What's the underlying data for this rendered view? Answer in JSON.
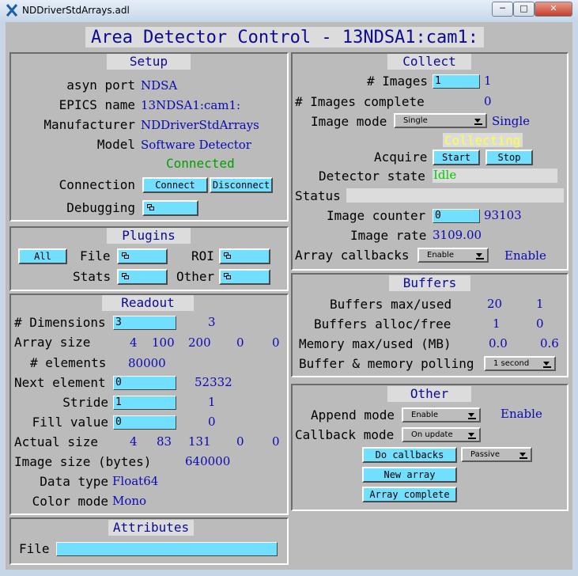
{
  "window": {
    "title": "NDDriverStdArrays.adl",
    "minimize": "─",
    "maximize": "□",
    "close": "✕"
  },
  "main_title": "Area Detector Control - 13NDSA1:cam1:",
  "setup": {
    "title": "Setup",
    "asyn_port_label": "asyn port",
    "asyn_port": "NDSA",
    "epics_name_label": "EPICS name",
    "epics_name": "13NDSA1:cam1:",
    "manufacturer_label": "Manufacturer",
    "manufacturer": "NDDriverStdArrays",
    "model_label": "Model",
    "model": "Software Detector",
    "connection_status": "Connected",
    "connection_label": "Connection",
    "connect_btn": "Connect",
    "disconnect_btn": "Disconnect",
    "debugging_label": "Debugging"
  },
  "plugins": {
    "title": "Plugins",
    "all_btn": "All",
    "file_label": "File",
    "roi_label": "ROI",
    "stats_label": "Stats",
    "other_label": "Other"
  },
  "readout": {
    "title": "Readout",
    "dims_label": "# Dimensions",
    "dims_input": "3",
    "dims_value": "3",
    "array_size_label": "Array size",
    "array_size": [
      "4",
      "100",
      "200",
      "0",
      "0"
    ],
    "elements_label": "# elements",
    "elements": "80000",
    "next_label": "Next element",
    "next_input": "0",
    "next_value": "52332",
    "stride_label": "Stride",
    "stride_input": "1",
    "stride_value": "1",
    "fill_label": "Fill value",
    "fill_input": "0",
    "fill_value": "0",
    "actual_label": "Actual size",
    "actual_size": [
      "4",
      "83",
      "131",
      "0",
      "0"
    ],
    "image_bytes_label": "Image size (bytes)",
    "image_bytes": "640000",
    "data_type_label": "Data type",
    "data_type": "Float64",
    "color_mode_label": "Color mode",
    "color_mode": "Mono"
  },
  "attributes": {
    "title": "Attributes",
    "file_label": "File",
    "file_value": ""
  },
  "collect": {
    "title": "Collect",
    "images_label": "# Images",
    "images_input": "1",
    "images_value": "1",
    "complete_label": "# Images complete",
    "complete_value": "0",
    "mode_label": "Image mode",
    "mode_select": "Single",
    "mode_value": "Single",
    "collecting": "Collecting",
    "acquire_label": "Acquire",
    "start_btn": "Start",
    "stop_btn": "Stop",
    "state_label": "Detector state",
    "state_value": "Idle",
    "status_label": "Status",
    "status_value": "",
    "counter_label": "Image counter",
    "counter_input": "0",
    "counter_value": "93103",
    "rate_label": "Image rate",
    "rate_value": "3109.00",
    "callbacks_label": "Array callbacks",
    "callbacks_select": "Enable",
    "callbacks_value": "Enable"
  },
  "buffers": {
    "title": "Buffers",
    "max_used_label": "Buffers max/used",
    "max": "20",
    "used": "1",
    "alloc_free_label": "Buffers alloc/free",
    "alloc": "1",
    "free": "0",
    "memory_label": "Memory max/used (MB)",
    "mem_max": "0.0",
    "mem_used": "0.6",
    "polling_label": "Buffer & memory polling",
    "polling_select": "1 second"
  },
  "other": {
    "title": "Other",
    "append_label": "Append mode",
    "append_select": "Enable",
    "append_value": "Enable",
    "callback_label": "Callback mode",
    "callback_select": "On update",
    "do_callbacks_btn": "Do callbacks",
    "passive_select": "Passive",
    "new_array_btn": "New array",
    "array_complete_btn": "Array complete"
  },
  "colors": {
    "input": "#73dfff",
    "value_text": "#0a0ab4",
    "connected": "#00a000",
    "collecting": "#ffff40",
    "idle": "#00cc00",
    "panel_bg": "#bbbbbb"
  }
}
